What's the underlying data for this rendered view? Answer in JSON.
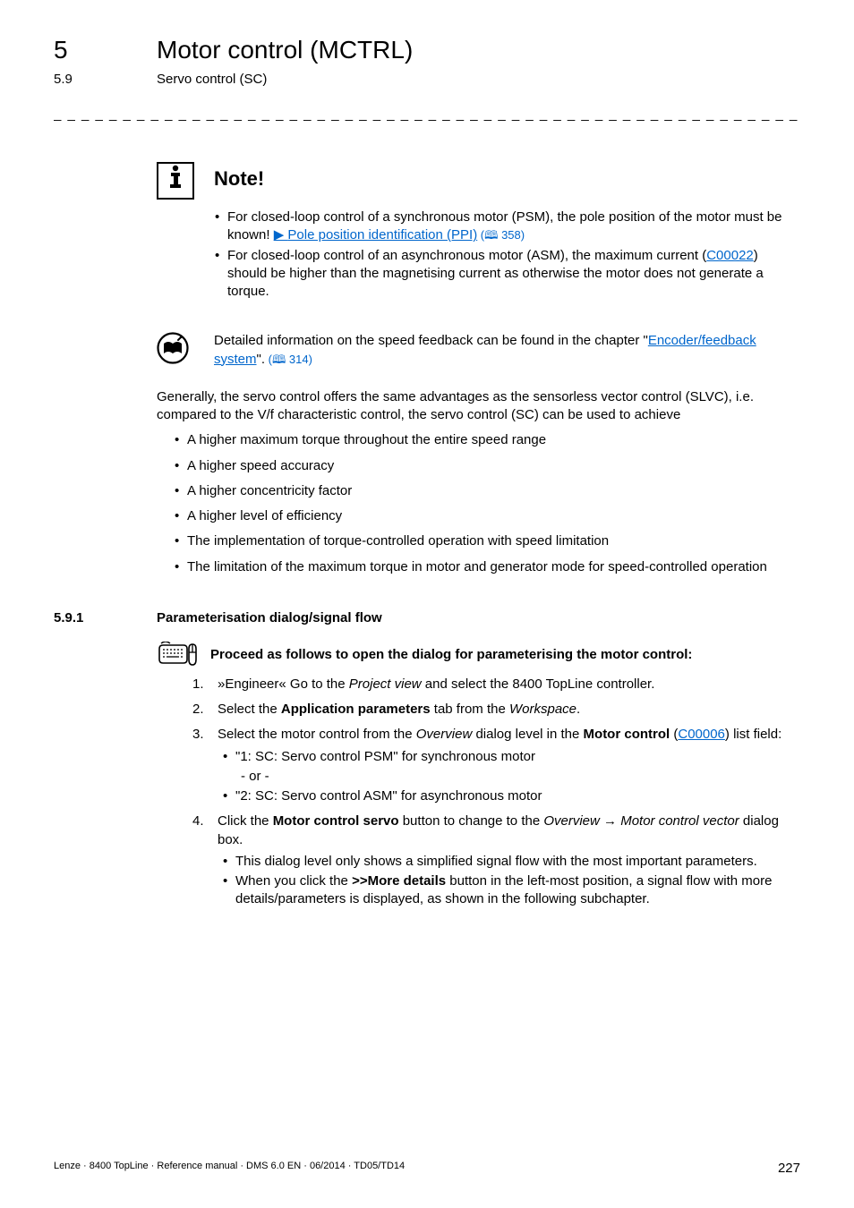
{
  "header": {
    "chapnum": "5",
    "chaptitle": "Motor control (MCTRL)",
    "subnum": "5.9",
    "subtitle": "Servo control (SC)"
  },
  "dashes": "_ _ _ _ _ _ _ _ _ _ _ _ _ _ _ _ _ _ _ _ _ _ _ _ _ _ _ _ _ _ _ _ _ _ _ _ _ _ _ _ _ _ _ _ _ _ _ _ _ _ _ _ _ _ _ _ _ _ _ _ _ _ _ _",
  "note": {
    "label": "Note!",
    "b1_a": "For closed-loop control of a synchronous motor (PSM), the pole position of the motor must be known! ",
    "b1_chev": "▶ ",
    "b1_link": "Pole position identification (PPI)",
    "b1_ref": " (🕮 358)",
    "b2_a": "For closed-loop control of an asynchronous motor (ASM), the maximum current (",
    "b2_link": "C00022",
    "b2_b": ") should be higher than the magnetising current as otherwise the motor does not generate a torque."
  },
  "tip": {
    "a": "Detailed information on the speed feedback can be found in the chapter \"",
    "link": "Encoder/feedback system",
    "b": "\".",
    "ref": " (🕮 314)"
  },
  "body": {
    "intro": "Generally, the servo control offers the same advantages as the sensorless vector control (SLVC), i.e. compared to the V/f characteristic control, the servo control (SC) can be used to achieve",
    "l1": "A higher maximum torque throughout the entire speed range",
    "l2": "A higher speed accuracy",
    "l3": "A higher concentricity factor",
    "l4": "A higher level of efficiency",
    "l5": "The implementation of torque-controlled operation with speed limitation",
    "l6": "The limitation of the maximum torque in motor and generator mode for speed-controlled operation"
  },
  "section": {
    "num": "5.9.1",
    "title": "Parameterisation dialog/signal flow"
  },
  "proceed": "Proceed as follows to open the dialog for parameterising the motor control:",
  "steps": {
    "s1_a": "»Engineer« Go to the ",
    "s1_i": "Project view",
    "s1_b": " and select the 8400 TopLine controller.",
    "s2_a": "Select the ",
    "s2_bold": "Application parameters",
    "s2_b": " tab from the ",
    "s2_i": "Workspace",
    "s2_c": ".",
    "s3_a": "Select the motor control from the ",
    "s3_i": "Overview",
    "s3_b": " dialog level in the ",
    "s3_bold": "Motor control",
    "s3_c": " (",
    "s3_link": "C00006",
    "s3_d": ") list field:",
    "s3_sub1": "\"1: SC: Servo control PSM\" for synchronous motor",
    "s3_or": "- or -",
    "s3_sub2": "\"2: SC: Servo control ASM\" for asynchronous motor",
    "s4_a": "Click the ",
    "s4_bold": "Motor control servo",
    "s4_b": " button to change to the ",
    "s4_i1": "Overview",
    "s4_arrow": " → ",
    "s4_i2": "Motor control vector",
    "s4_c": " dialog box.",
    "s4_sub1": "This dialog level only shows a simplified signal flow with the most important parameters.",
    "s4_sub2a": "When you click the ",
    "s4_sub2bold": ">>More details",
    "s4_sub2b": " button in the left-most position, a signal flow with more details/parameters is displayed, as shown in the following subchapter."
  },
  "footer": {
    "left": "Lenze · 8400 TopLine · Reference manual · DMS 6.0 EN · 06/2014 · TD05/TD14",
    "right": "227"
  }
}
